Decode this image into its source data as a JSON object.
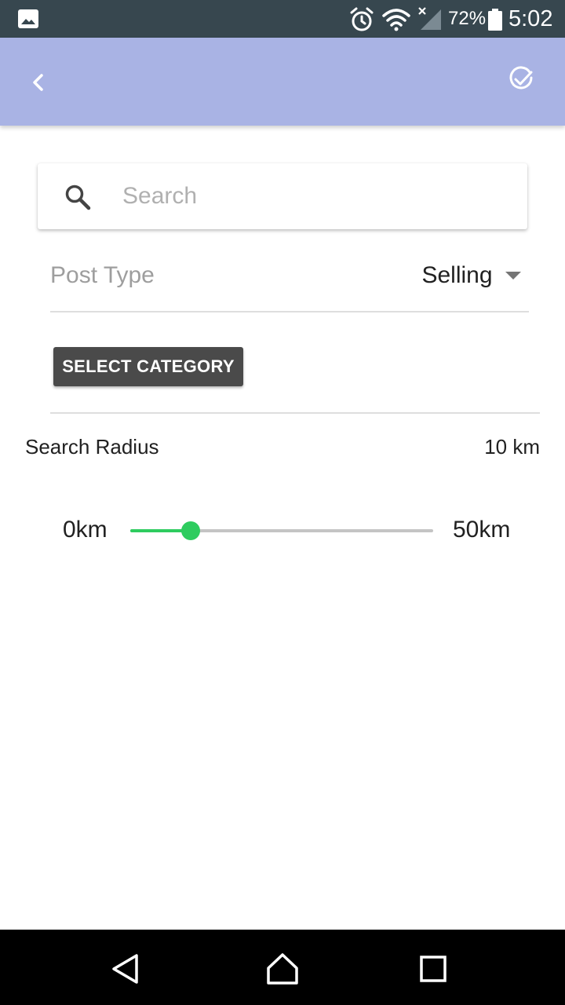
{
  "status_bar": {
    "battery_percent": "72%",
    "time": "5:02",
    "icons": [
      "gallery-icon",
      "alarm-icon",
      "wifi-icon",
      "signal-icon",
      "battery-icon"
    ]
  },
  "app_bar": {
    "background_color": "#a9b3e4",
    "back_icon": "chevron-left-icon",
    "confirm_icon": "check-circle-icon"
  },
  "search": {
    "placeholder": "Search",
    "value": ""
  },
  "post_type": {
    "label": "Post Type",
    "selected": "Selling"
  },
  "category_button": {
    "label": "SELECT CATEGORY"
  },
  "search_radius": {
    "label": "Search Radius",
    "value_text": "10 km",
    "min_label": "0km",
    "max_label": "50km",
    "min": 0,
    "max": 50,
    "value": 10,
    "accent_color": "#2ecc5f"
  },
  "nav_bar": {
    "icons": [
      "nav-back-icon",
      "nav-home-icon",
      "nav-recents-icon"
    ]
  }
}
